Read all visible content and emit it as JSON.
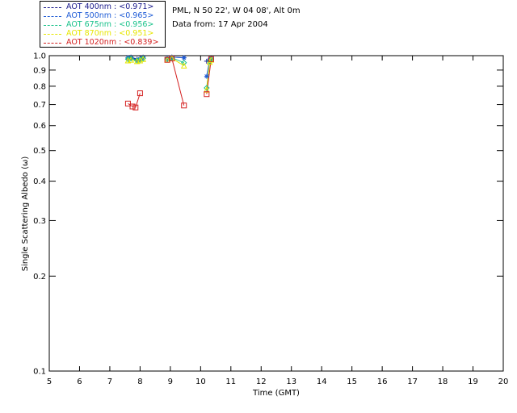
{
  "header": {
    "location": "PML, N 50 22', W 04 08', Alt 0m",
    "date_line": "Data from: 17 Apr 2004"
  },
  "legend": [
    {
      "label": "AOT  400nm : <0.971>",
      "color": "#1a1a8c"
    },
    {
      "label": "AOT  500nm : <0.965>",
      "color": "#1e5bd6"
    },
    {
      "label": "AOT  675nm : <0.956>",
      "color": "#19c28a"
    },
    {
      "label": "AOT  870nm : <0.951>",
      "color": "#e6e600"
    },
    {
      "label": "AOT 1020nm : <0.839>",
      "color": "#d42020"
    }
  ],
  "chart_data": {
    "type": "scatter",
    "xlabel": "Time (GMT)",
    "ylabel": "Single Scattering Albedo (ω)",
    "xlim": [
      5,
      20
    ],
    "ylim": [
      0.1,
      1.0
    ],
    "yscale": "log",
    "xticks": [
      5,
      6,
      7,
      8,
      9,
      10,
      11,
      12,
      13,
      14,
      15,
      16,
      17,
      18,
      19,
      20
    ],
    "yticks": [
      0.1,
      0.2,
      0.3,
      0.4,
      0.5,
      0.6,
      0.7,
      0.8,
      0.9,
      1.0
    ],
    "ytick_labels": [
      "0.1",
      "0.2",
      "0.3",
      "0.4",
      "0.5",
      "0.6",
      "0.7",
      "0.8",
      "0.9",
      "1.0"
    ],
    "grid": false,
    "legend_position": "top-left outside",
    "series": [
      {
        "name": "AOT  400nm : <0.971>",
        "marker": "plus",
        "color": "#1a1a8c",
        "x": [
          7.6,
          7.7,
          7.9,
          8.0,
          8.1,
          8.9,
          9.05,
          9.45,
          10.2,
          10.3,
          10.35
        ],
        "y": [
          0.985,
          0.99,
          0.975,
          0.98,
          0.99,
          0.985,
          0.99,
          0.985,
          0.96,
          0.97,
          0.975
        ]
      },
      {
        "name": "AOT  500nm : <0.965>",
        "marker": "asterisk",
        "color": "#1e5bd6",
        "x": [
          7.6,
          7.7,
          7.9,
          8.0,
          8.1,
          8.9,
          9.05,
          9.45,
          10.2,
          10.3,
          10.35
        ],
        "y": [
          0.985,
          0.985,
          0.97,
          0.975,
          0.985,
          0.98,
          0.99,
          0.985,
          0.86,
          0.97,
          0.98
        ]
      },
      {
        "name": "AOT  675nm : <0.956>",
        "marker": "diamond",
        "color": "#19c28a",
        "x": [
          7.6,
          7.7,
          7.9,
          8.0,
          8.1,
          8.9,
          9.05,
          9.45,
          10.2,
          10.3,
          10.35
        ],
        "y": [
          0.975,
          0.98,
          0.965,
          0.97,
          0.98,
          0.975,
          0.985,
          0.95,
          0.79,
          0.96,
          0.975
        ]
      },
      {
        "name": "AOT  870nm : <0.951>",
        "marker": "triangle",
        "color": "#e6e600",
        "x": [
          7.6,
          7.7,
          7.9,
          8.0,
          8.1,
          8.9,
          9.05,
          9.45,
          10.2,
          10.3,
          10.35
        ],
        "y": [
          0.965,
          0.97,
          0.96,
          0.965,
          0.975,
          0.97,
          0.98,
          0.93,
          0.78,
          0.955,
          0.97
        ]
      },
      {
        "name": "AOT 1020nm : <0.839>",
        "marker": "square",
        "color": "#d42020",
        "x": [
          7.6,
          7.75,
          7.85,
          8.0,
          8.9,
          9.05,
          9.45,
          10.2,
          10.35
        ],
        "y": [
          0.705,
          0.69,
          0.685,
          0.76,
          0.97,
          0.98,
          0.695,
          0.755,
          0.975
        ]
      }
    ]
  }
}
